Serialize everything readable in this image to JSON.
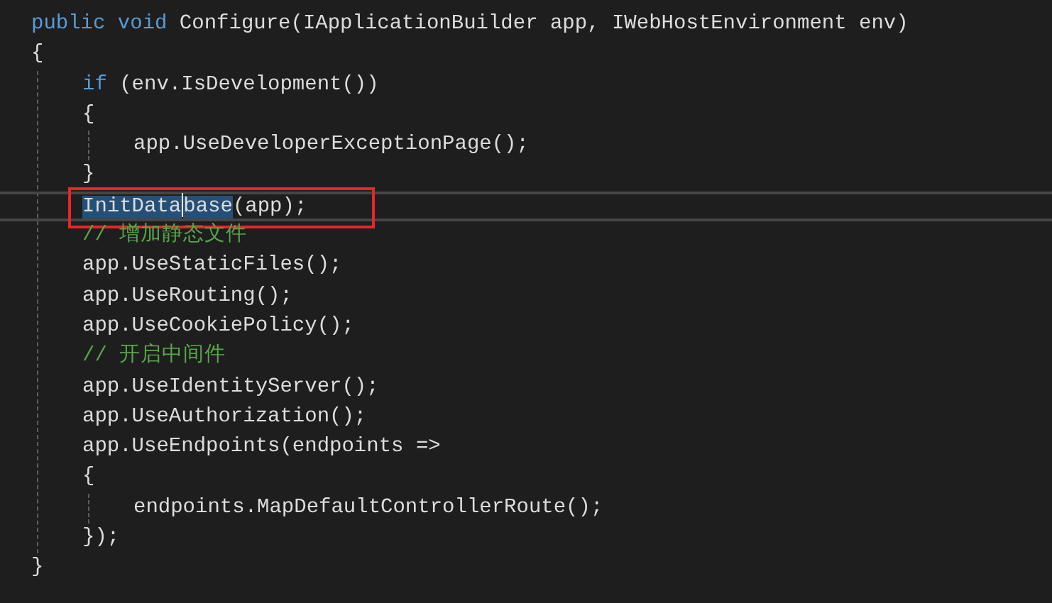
{
  "code": [
    {
      "tokens": [
        {
          "text": "public",
          "kind": "keyword"
        },
        {
          "text": " void",
          "kind": "keyword"
        },
        {
          "text": " Configure(IApplicationBuilder app, IWebHostEnvironment env)",
          "kind": "plain"
        }
      ]
    },
    {
      "tokens": [
        {
          "text": "{",
          "kind": "plain"
        }
      ],
      "children": [
        {
          "tokens": [
            {
              "text": "if",
              "kind": "keyword"
            },
            {
              "text": " (env.IsDevelopment())",
              "kind": "plain"
            }
          ]
        },
        {
          "tokens": [
            {
              "text": "{",
              "kind": "plain"
            }
          ],
          "children": [
            {
              "tokens": [
                {
                  "text": "app.UseDeveloperExceptionPage();",
                  "kind": "plain"
                }
              ]
            }
          ]
        },
        {
          "tokens": [
            {
              "text": "}",
              "kind": "plain"
            }
          ]
        },
        {
          "tokens": [
            {
              "text": "InitData",
              "kind": "selected"
            },
            {
              "text": "base",
              "kind": "selected_caret"
            },
            {
              "text": "(app);",
              "kind": "plain"
            }
          ],
          "current": true,
          "annotated": true
        },
        {
          "tokens": [
            {
              "text": "// 增加静态文件",
              "kind": "comment"
            }
          ]
        },
        {
          "tokens": [
            {
              "text": "app.UseStaticFiles();",
              "kind": "plain"
            }
          ]
        },
        {
          "tokens": [
            {
              "text": "app.UseRouting();",
              "kind": "plain"
            }
          ]
        },
        {
          "tokens": [
            {
              "text": "app.UseCookiePolicy();",
              "kind": "plain"
            }
          ]
        },
        {
          "tokens": [
            {
              "text": "// 开启中间件",
              "kind": "comment"
            }
          ]
        },
        {
          "tokens": [
            {
              "text": "app.UseIdentityServer();",
              "kind": "plain"
            }
          ]
        },
        {
          "tokens": [
            {
              "text": "app.UseAuthorization();",
              "kind": "plain"
            }
          ]
        },
        {
          "tokens": [
            {
              "text": "app.UseEndpoints(endpoints =>",
              "kind": "plain"
            }
          ]
        },
        {
          "tokens": [
            {
              "text": "{",
              "kind": "plain"
            }
          ],
          "children": [
            {
              "tokens": [
                {
                  "text": "endpoints.MapDefaultControllerRoute();",
                  "kind": "plain"
                }
              ]
            }
          ]
        },
        {
          "tokens": [
            {
              "text": "});",
              "kind": "plain"
            }
          ]
        }
      ]
    },
    {
      "tokens": [
        {
          "text": "}",
          "kind": "plain"
        }
      ]
    }
  ]
}
